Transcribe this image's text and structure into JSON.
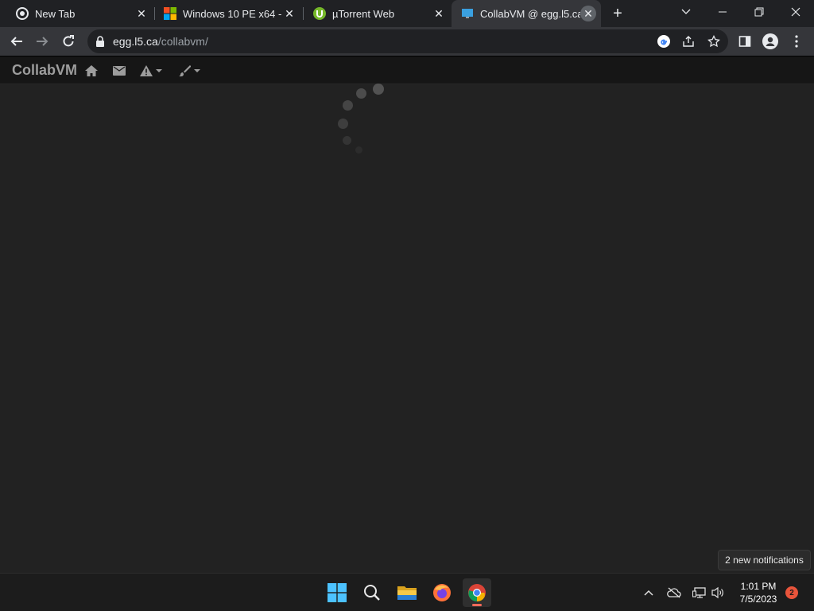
{
  "browser": {
    "tabs": [
      {
        "title": "New Tab",
        "icon": "chrome-icon",
        "active": false
      },
      {
        "title": "Windows 10 PE x64 - x",
        "icon": "windows-logo-icon",
        "active": false
      },
      {
        "title": "µTorrent Web",
        "icon": "utorrent-icon",
        "active": false
      },
      {
        "title": "CollabVM @ egg.l5.ca",
        "icon": "monitor-icon",
        "active": true
      }
    ],
    "address": {
      "host": "egg.l5.ca",
      "path": "/collabvm/"
    }
  },
  "page": {
    "brand": "CollabVM",
    "nav_icons": [
      "home-icon",
      "envelope-icon",
      "warning-icon",
      "brush-icon"
    ],
    "status": "loading"
  },
  "notification_toast": "2 new notifications",
  "taskbar": {
    "apps": [
      "start-icon",
      "search-icon",
      "file-explorer-icon",
      "firefox-icon",
      "chrome-icon"
    ],
    "time": "1:01 PM",
    "date": "7/5/2023",
    "notification_count": "2"
  },
  "colors": {
    "page_bg": "#222222",
    "navbar_bg": "#161616",
    "tab_active": "#35363a",
    "badge": "#e8543b"
  }
}
